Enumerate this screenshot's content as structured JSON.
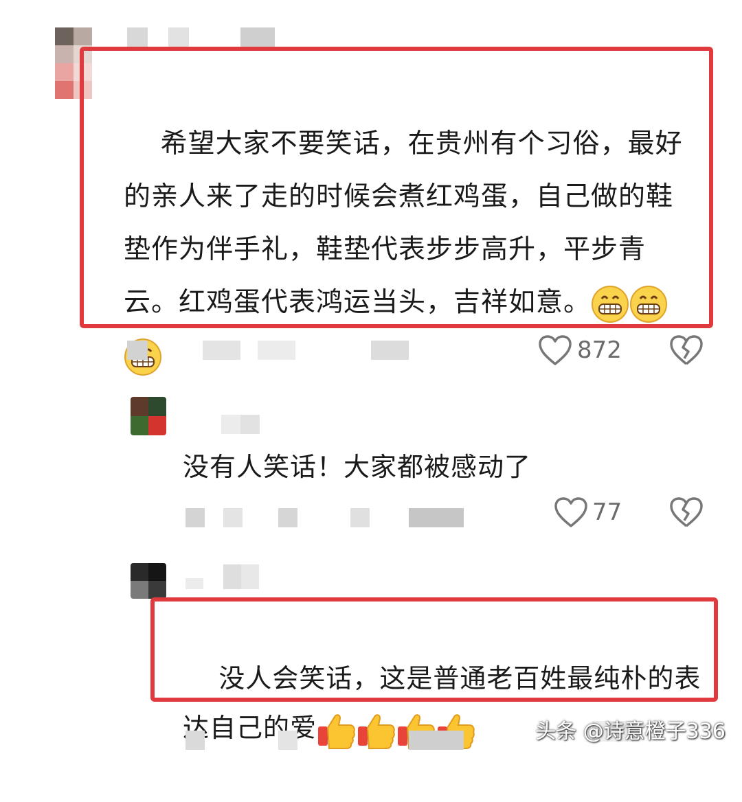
{
  "comments": [
    {
      "text": "希望大家不要笑话，在贵州有个习俗，最好的亲人来了走的时候会煮红鸡蛋，自己做的鞋垫作为伴手礼，鞋垫代表步步高升，平步青云。红鸡蛋代表鸿运当头，吉祥如意。",
      "emoji": "grin-emoji",
      "emoji_count": 3,
      "likes": "872",
      "highlight_color": "#e03a3e"
    },
    {
      "text": "没有人笑话！大家都被感动了",
      "likes": "77"
    },
    {
      "text": "没人会笑话，这是普通老百姓最纯朴的表达自己的爱",
      "emoji": "thumbs-up-emoji",
      "emoji_count": 4,
      "likes": "",
      "highlight_color": "#e03a3e"
    }
  ],
  "watermark": "头条 @诗意橙子336",
  "icons": {
    "like": "heart-outline-icon",
    "dislike": "broken-heart-icon"
  },
  "colors": {
    "highlight": "#e03a3e",
    "text": "#1a1a1a",
    "muted": "#6b6b6b"
  }
}
